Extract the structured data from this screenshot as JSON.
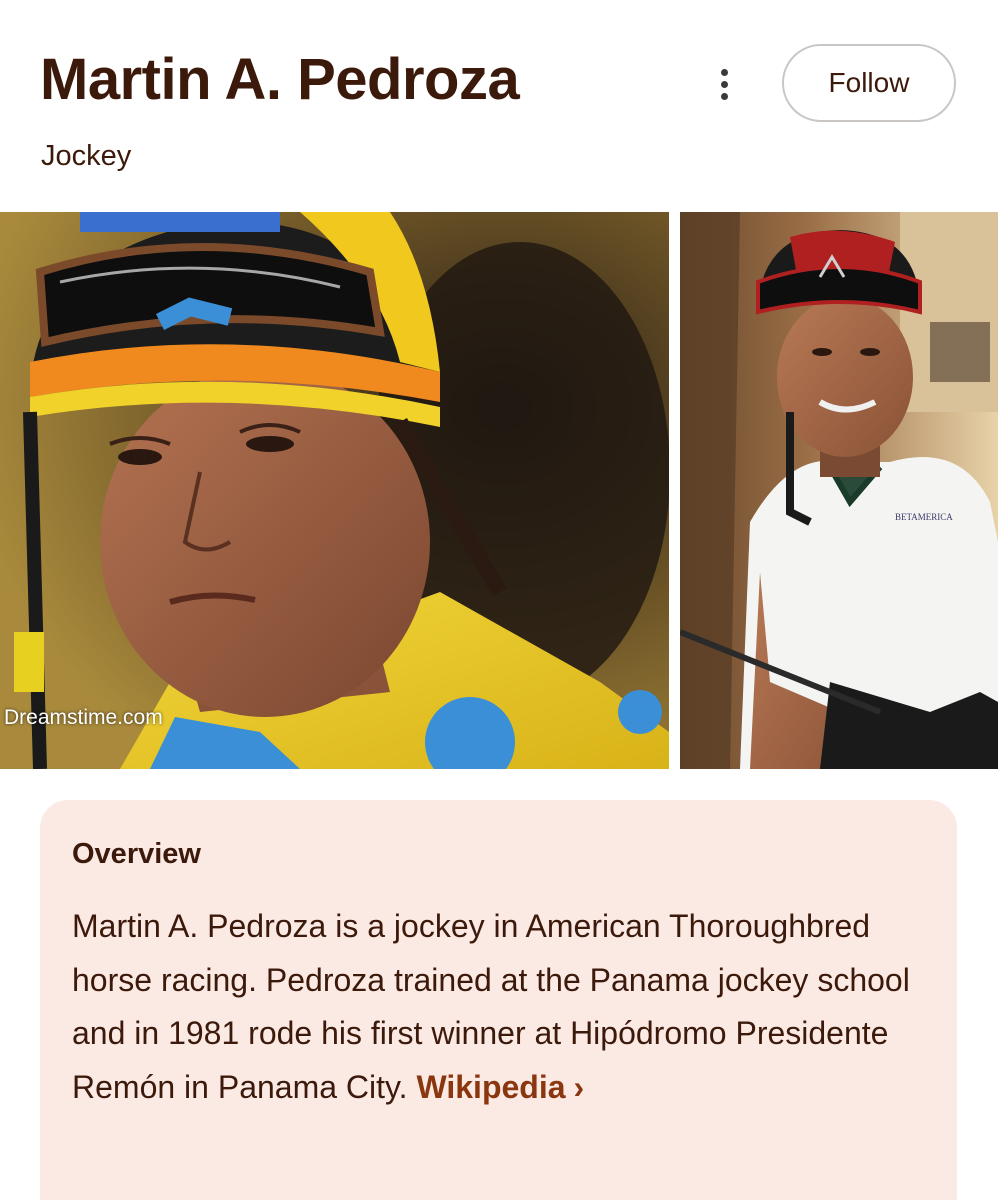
{
  "header": {
    "title": "Martin A. Pedroza",
    "subtitle": "Jockey",
    "more_icon": "vertical-ellipsis-icon",
    "follow_label": "Follow"
  },
  "gallery": {
    "images": [
      {
        "name": "jockey-portrait-yellow-silks",
        "watermark": "Dreamstime.com"
      },
      {
        "name": "jockey-portrait-white-shirt",
        "shirt_text": "BETAMERICA"
      }
    ]
  },
  "overview": {
    "heading": "Overview",
    "text": "Martin A. Pedroza is a jockey in American Thoroughbred horse racing. Pedroza trained at the Panama jockey school and in 1981 rode his first winner at Hipódromo Presidente Remón in Panama City.",
    "source_label": "Wikipedia",
    "source_icon": "chevron-right-icon",
    "source_chevron": "›"
  },
  "colors": {
    "text": "#3c1a0b",
    "link": "#8a3710",
    "panel_bg": "#fbe9e4",
    "button_border": "#c9c6c4"
  }
}
